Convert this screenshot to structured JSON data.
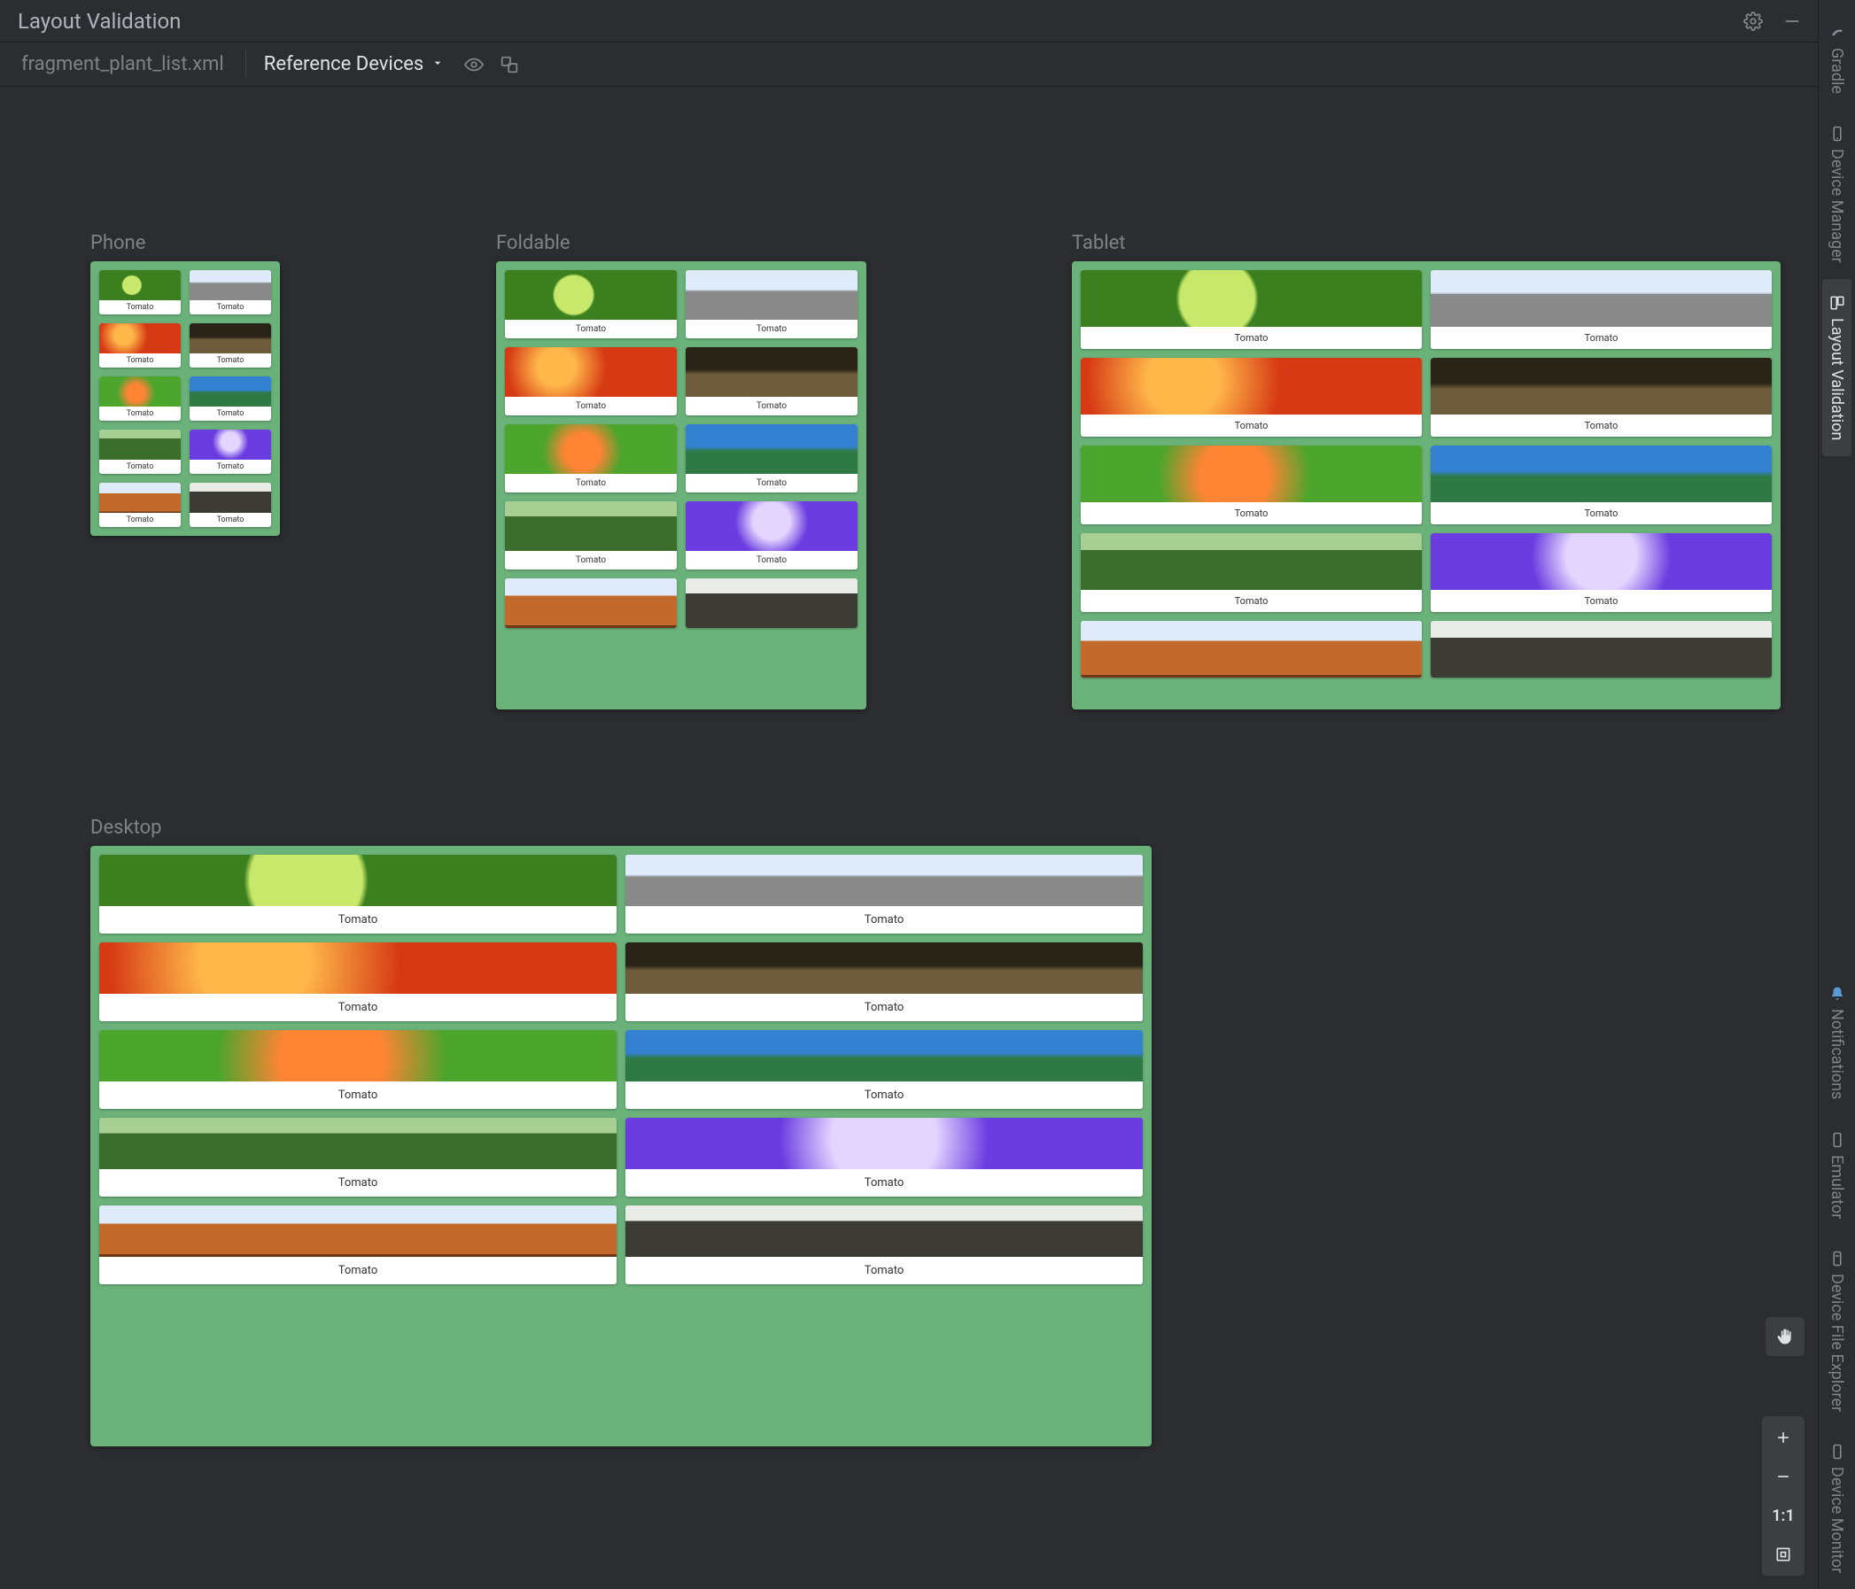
{
  "header": {
    "title": "Layout Validation"
  },
  "toolbar": {
    "file_name": "fragment_plant_list.xml",
    "dropdown_label": "Reference Devices"
  },
  "right_rail": {
    "items": [
      {
        "label": "Gradle",
        "active": false
      },
      {
        "label": "Device Manager",
        "active": false
      },
      {
        "label": "Layout Validation",
        "active": true
      },
      {
        "label": "Notifications",
        "active": false
      },
      {
        "label": "Emulator",
        "active": false
      },
      {
        "label": "Device File Explorer",
        "active": false
      },
      {
        "label": "Device Monitor",
        "active": false
      }
    ]
  },
  "devices": {
    "phone": {
      "label": "Phone",
      "item_label": "Tomato",
      "count": 10
    },
    "foldable": {
      "label": "Foldable",
      "item_label": "Tomato",
      "count": 10
    },
    "tablet": {
      "label": "Tablet",
      "item_label": "Tomato",
      "count": 10
    },
    "desktop": {
      "label": "Desktop",
      "item_label": "Tomato",
      "count": 10
    }
  },
  "zoom": {
    "one_to_one": "1:1"
  }
}
